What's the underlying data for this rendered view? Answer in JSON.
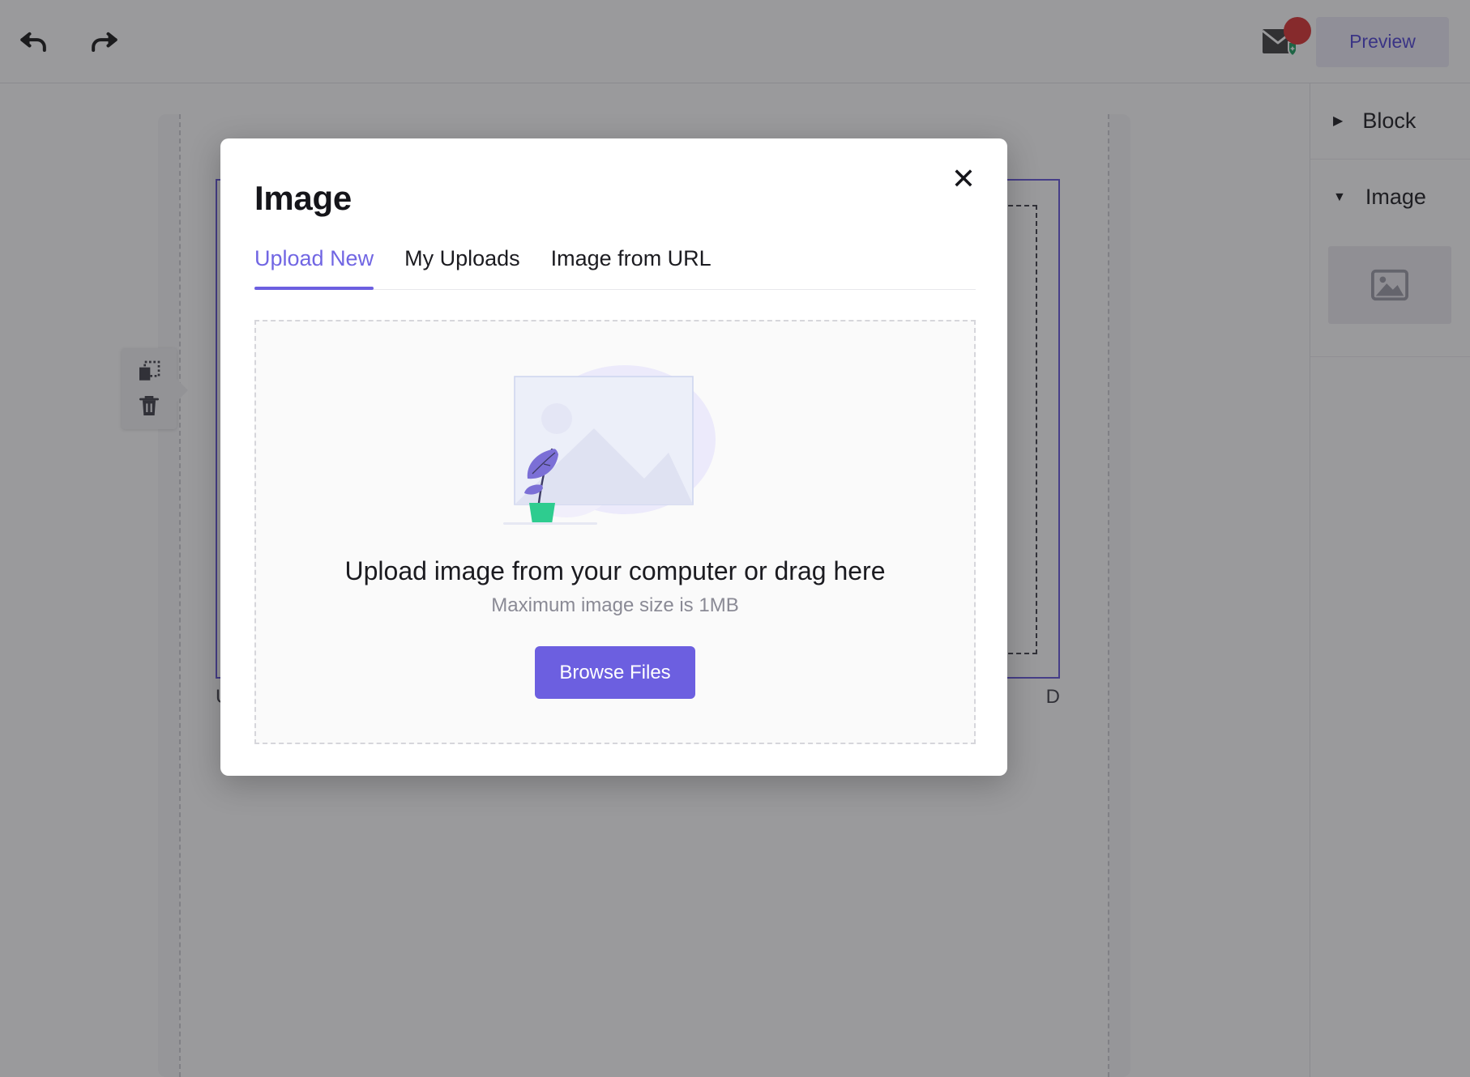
{
  "topbar": {
    "undo_label": "Undo",
    "redo_label": "Redo",
    "mail_icon": "mail-shield-icon",
    "notification_badge": "",
    "preview_label": "Preview"
  },
  "canvas": {
    "element_toolbar": {
      "duplicate_label": "Duplicate",
      "delete_label": "Delete"
    },
    "caption_left": "U",
    "caption_right": "D"
  },
  "sidebar": {
    "sections": [
      {
        "label": "Block",
        "caret": "▶",
        "expanded": false
      },
      {
        "label": "Image",
        "caret": "▼",
        "expanded": true
      }
    ],
    "image_placeholder_icon": "image-placeholder-icon"
  },
  "modal": {
    "title": "Image",
    "close_label": "✕",
    "tabs": [
      {
        "label": "Upload New",
        "active": true
      },
      {
        "label": "My Uploads",
        "active": false
      },
      {
        "label": "Image from URL",
        "active": false
      }
    ],
    "dropzone": {
      "illustration": "image-upload-illustration",
      "title": "Upload image from your computer or drag here",
      "subtitle": "Maximum image size is 1MB",
      "browse_label": "Browse Files"
    }
  },
  "colors": {
    "accent": "#6c5fe0",
    "accent_text": "#7166e3",
    "preview_text": "#4b3fd4",
    "badge_red": "#d92d2d",
    "shield_green": "#159c5b",
    "selection_border": "#6152d9",
    "pot_green": "#2ecc8f"
  }
}
